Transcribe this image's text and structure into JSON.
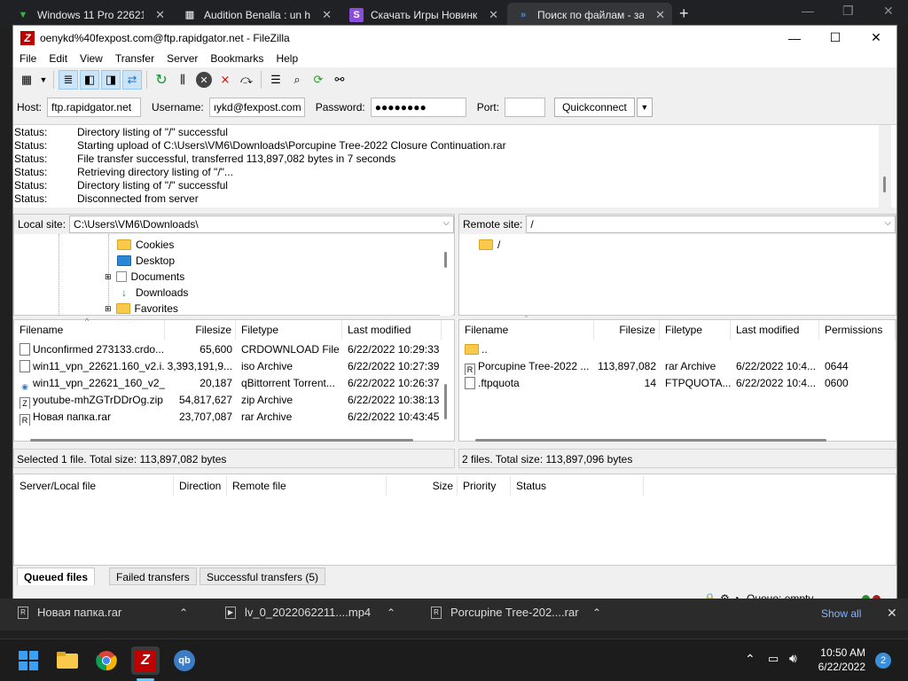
{
  "browser": {
    "tabs": [
      {
        "title": "Windows 11 Pro 22621",
        "icon": "green-leaf-icon",
        "active": false
      },
      {
        "title": "Audition Benalla : un h",
        "icon": "building-icon",
        "active": false
      },
      {
        "title": "Скачать Игры Новинки",
        "icon": "s-purple-icon",
        "active": false
      },
      {
        "title": "Поиск по файлам - за",
        "icon": "blue-chevron-icon",
        "active": true
      }
    ]
  },
  "window": {
    "title": "oenykd%40fexpost.com@ftp.rapidgator.net - FileZilla"
  },
  "menu": [
    "File",
    "Edit",
    "View",
    "Transfer",
    "Server",
    "Bookmarks",
    "Help"
  ],
  "quickconnect": {
    "host_label": "Host:",
    "host": "ftp.rapidgator.net",
    "user_label": "Username:",
    "user": "ıykd@fexpost.com",
    "pass_label": "Password:",
    "pass": "●●●●●●●●",
    "port_label": "Port:",
    "port": "",
    "button": "Quickconnect"
  },
  "log": [
    {
      "label": "Status:",
      "text": "Directory listing of \"/\" successful"
    },
    {
      "label": "Status:",
      "text": "Starting upload of C:\\Users\\VM6\\Downloads\\Porcupine Tree-2022 Closure Continuation.rar"
    },
    {
      "label": "Status:",
      "text": "File transfer successful, transferred 113,897,082 bytes in 7 seconds"
    },
    {
      "label": "Status:",
      "text": "Retrieving directory listing of \"/\"..."
    },
    {
      "label": "Status:",
      "text": "Directory listing of \"/\" successful"
    },
    {
      "label": "Status:",
      "text": "Disconnected from server"
    }
  ],
  "local": {
    "label": "Local site:",
    "path": "C:\\Users\\VM6\\Downloads\\",
    "tree": [
      "Cookies",
      "Desktop",
      "Documents",
      "Downloads",
      "Favorites"
    ],
    "headers": [
      "Filename",
      "Filesize",
      "Filetype",
      "Last modified"
    ],
    "files": [
      {
        "name": "Unconfirmed 273133.crdo...",
        "size": "65,600",
        "type": "CRDOWNLOAD File",
        "modified": "6/22/2022 10:29:33..."
      },
      {
        "name": "win11_vpn_22621.160_v2.i...",
        "size": "3,393,191,9...",
        "type": "iso Archive",
        "modified": "6/22/2022 10:27:39..."
      },
      {
        "name": "win11_vpn_22621_160_v2_...",
        "size": "20,187",
        "type": "qBittorrent Torrent...",
        "modified": "6/22/2022 10:26:37..."
      },
      {
        "name": "youtube-mhZGTrDDrOg.zip",
        "size": "54,817,627",
        "type": "zip Archive",
        "modified": "6/22/2022 10:38:13..."
      },
      {
        "name": "Новая папка.rar",
        "size": "23,707,087",
        "type": "rar Archive",
        "modified": "6/22/2022 10:43:45..."
      }
    ],
    "status": "Selected 1 file. Total size: 113,897,082 bytes"
  },
  "remote": {
    "label": "Remote site:",
    "path": "/",
    "tree": [
      "/"
    ],
    "headers": [
      "Filename",
      "Filesize",
      "Filetype",
      "Last modified",
      "Permissions"
    ],
    "files": [
      {
        "name": "..",
        "size": "",
        "type": "",
        "modified": "",
        "perm": ""
      },
      {
        "name": "Porcupine Tree-2022 ...",
        "size": "113,897,082",
        "type": "rar Archive",
        "modified": "6/22/2022 10:4...",
        "perm": "0644"
      },
      {
        "name": ".ftpquota",
        "size": "14",
        "type": "FTPQUOTA...",
        "modified": "6/22/2022 10:4...",
        "perm": "0600"
      }
    ],
    "status": "2 files. Total size: 113,897,096 bytes"
  },
  "queue": {
    "headers": [
      "Server/Local file",
      "Direction",
      "Remote file",
      "Size",
      "Priority",
      "Status"
    ],
    "tabs": [
      "Queued files",
      "Failed transfers",
      "Successful transfers (5)"
    ],
    "status": "Queue: empty"
  },
  "downloads": [
    {
      "name": "Новая папка.rar"
    },
    {
      "name": "lv_0_2022062211....mp4"
    },
    {
      "name": "Porcupine Tree-202....rar"
    }
  ],
  "downloads_show_all": "Show all",
  "clock": {
    "time": "10:50 AM",
    "date": "6/22/2022"
  },
  "notification_count": "2",
  "colors": {
    "accent": "#0078d7",
    "filezilla": "#bf0000",
    "folder": "#f8c94a"
  }
}
